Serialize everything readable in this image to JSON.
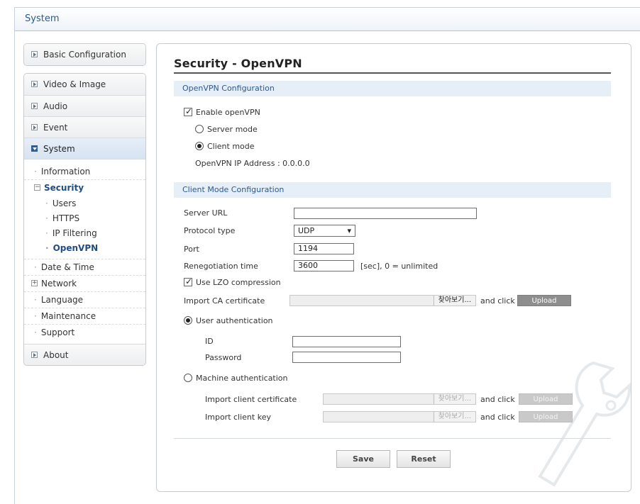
{
  "app": {
    "title": "System"
  },
  "sidebar": {
    "basic_config": "Basic Configuration",
    "menu": [
      "Video & Image",
      "Audio",
      "Event",
      "System"
    ],
    "system_sub": {
      "information": "Information",
      "security": "Security",
      "security_children": [
        "Users",
        "HTTPS",
        "IP Filtering",
        "OpenVPN"
      ],
      "date_time": "Date & Time",
      "network": "Network",
      "language": "Language",
      "maintenance": "Maintenance",
      "support": "Support"
    },
    "about": "About"
  },
  "page": {
    "title": "Security - OpenVPN",
    "openvpn_section": "OpenVPN Configuration",
    "enable_openvpn": "Enable openVPN",
    "server_mode": "Server mode",
    "client_mode": "Client mode",
    "ip_address_label": "OpenVPN IP Address : 0.0.0.0",
    "client_section": "Client Mode Configuration",
    "server_url_label": "Server URL",
    "server_url_value": "",
    "protocol_label": "Protocol type",
    "protocol_value": "UDP",
    "port_label": "Port",
    "port_value": "1194",
    "reneg_label": "Renegotiation time",
    "reneg_value": "3600",
    "reneg_unit": "[sec], 0 = unlimited",
    "lzo_label": "Use LZO compression",
    "import_ca_label": "Import CA certificate",
    "browse_label": "찾아보기...",
    "and_click": "and click",
    "upload_label": "Upload",
    "user_auth": "User authentication",
    "id_label": "ID",
    "password_label": "Password",
    "machine_auth": "Machine authentication",
    "import_client_cert": "Import client certificate",
    "import_client_key": "Import client key",
    "save_label": "Save",
    "reset_label": "Reset"
  },
  "state": {
    "enable_openvpn": true,
    "mode": "client",
    "use_lzo": true,
    "auth": "user"
  }
}
